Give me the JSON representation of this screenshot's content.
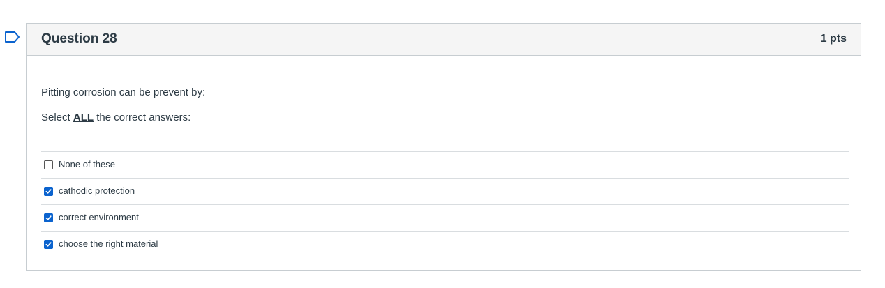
{
  "question": {
    "title": "Question 28",
    "points": "1 pts",
    "text": "Pitting corrosion can be prevent by:",
    "instruction_prefix": "Select ",
    "instruction_emphasis": "ALL",
    "instruction_suffix": " the correct answers:",
    "flag_icon": "flag-outline-icon",
    "accent_color": "#0b63ce"
  },
  "answers": [
    {
      "label": "None of these",
      "checked": false
    },
    {
      "label": "cathodic protection",
      "checked": true
    },
    {
      "label": "correct environment",
      "checked": true
    },
    {
      "label": "choose the right material",
      "checked": true
    }
  ]
}
